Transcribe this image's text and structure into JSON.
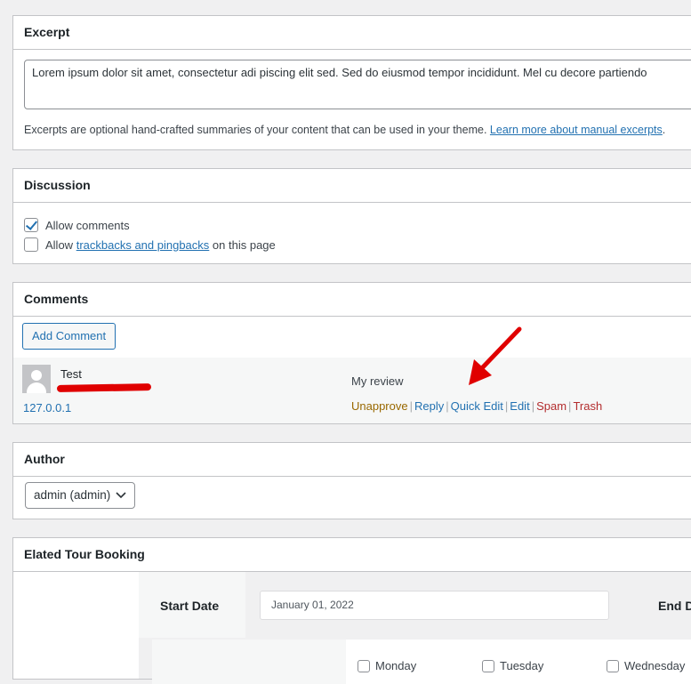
{
  "excerpt": {
    "title": "Excerpt",
    "value": "Lorem ipsum dolor sit amet, consectetur adi piscing elit sed. Sed do eiusmod tempor incididunt. Mel cu decore partiendo",
    "help_text": "Excerpts are optional hand-crafted summaries of your content that can be used in your theme.",
    "help_link": "Learn more about manual excerpts",
    "help_tail": "."
  },
  "discussion": {
    "title": "Discussion",
    "allow_comments": {
      "label": "Allow comments",
      "checked": true
    },
    "allow_trackbacks": {
      "prefix": "Allow",
      "link": "trackbacks and pingbacks",
      "suffix": "on this page",
      "checked": false
    }
  },
  "comments": {
    "title": "Comments",
    "add_button": "Add Comment",
    "items": [
      {
        "author": "Test",
        "ip": "127.0.0.1",
        "text": "My review",
        "actions": {
          "unapprove": "Unapprove",
          "reply": "Reply",
          "quick_edit": "Quick Edit",
          "edit": "Edit",
          "spam": "Spam",
          "trash": "Trash"
        }
      }
    ]
  },
  "author": {
    "title": "Author",
    "selected": "admin (admin)"
  },
  "tour_booking": {
    "title": "Elated Tour Booking",
    "start_date_label": "Start Date",
    "start_date_value": "January 01, 2022",
    "end_date_label": "End Date",
    "days": [
      "Monday",
      "Tuesday",
      "Wednesday"
    ]
  },
  "colors": {
    "accent": "#2271b1",
    "annotation_red": "#e00000",
    "unapprove": "#996800",
    "danger": "#b32d2e"
  }
}
